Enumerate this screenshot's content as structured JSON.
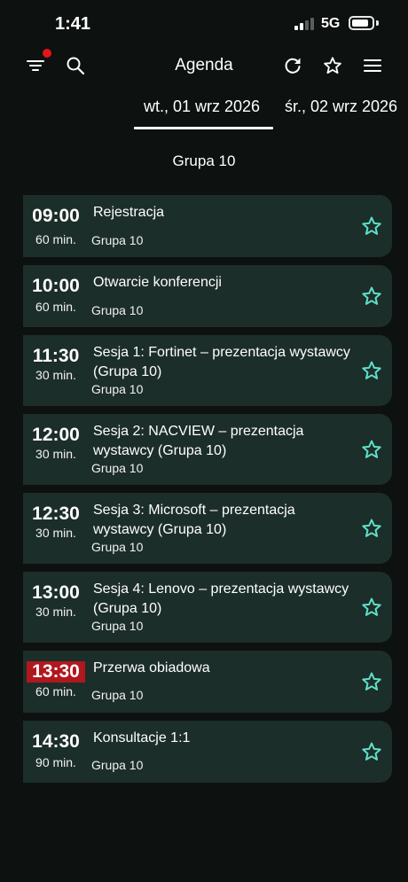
{
  "status_bar": {
    "time": "1:41",
    "network": "5G",
    "battery_level": 0.85
  },
  "toolbar": {
    "title": "Agenda",
    "icons": [
      "filter-icon",
      "search-icon",
      "refresh-icon",
      "star-outline-icon",
      "menu-icon"
    ],
    "filter_active": true
  },
  "date_tabs": [
    {
      "label": "wt., 01 wrz 2026",
      "selected": true
    },
    {
      "label": "śr., 02 wrz 2026",
      "selected": false
    }
  ],
  "group_header": "Grupa 10",
  "colors": {
    "background": "#0d1110",
    "card": "#1c2e29",
    "accent_star": "#5fe0c9",
    "highlight_time": "#b0171e",
    "filter_badge": "#e5141b"
  },
  "sessions": [
    {
      "time": "09:00",
      "duration": "60 min.",
      "title": "Rejestracja",
      "group": "Grupa 10",
      "favorite": false
    },
    {
      "time": "10:00",
      "duration": "60 min.",
      "title": "Otwarcie konferencji",
      "group": "Grupa 10",
      "favorite": false
    },
    {
      "time": "11:30",
      "duration": "30 min.",
      "title": "Sesja 1: Fortinet – prezentacja wystawcy (Grupa 10)",
      "group": "Grupa 10",
      "favorite": false
    },
    {
      "time": "12:00",
      "duration": "30 min.",
      "title": "Sesja 2: NACVIEW – prezentacja wystawcy (Grupa 10)",
      "group": "Grupa 10",
      "favorite": false
    },
    {
      "time": "12:30",
      "duration": "30 min.",
      "title": "Sesja 3: Microsoft – prezentacja wystawcy (Grupa 10)",
      "group": "Grupa 10",
      "favorite": false
    },
    {
      "time": "13:00",
      "duration": "30 min.",
      "title": "Sesja 4: Lenovo – prezentacja wystawcy (Grupa 10)",
      "group": "Grupa 10",
      "favorite": false
    },
    {
      "time": "13:30",
      "duration": "60 min.",
      "title": "Przerwa obiadowa",
      "group": "Grupa 10",
      "favorite": false,
      "current": true
    },
    {
      "time": "14:30",
      "duration": "90 min.",
      "title": "Konsultacje 1:1",
      "group": "Grupa 10",
      "favorite": false
    }
  ]
}
